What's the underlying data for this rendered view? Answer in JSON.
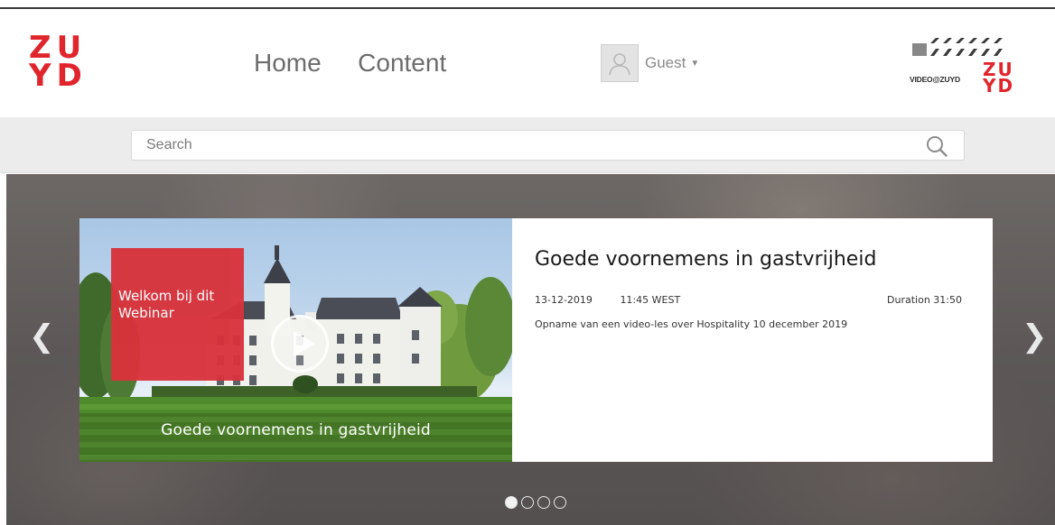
{
  "brand": {
    "logo_text": "ZUYD",
    "video_logo_text": "VIDEO@ZUYD",
    "brand_color": "#e0252c"
  },
  "nav": {
    "items": [
      {
        "label": "Home"
      },
      {
        "label": "Content"
      }
    ]
  },
  "user": {
    "name": "Guest",
    "avatar_icon": "user-silhouette-icon",
    "caret_icon": "caret-down-icon"
  },
  "search": {
    "placeholder": "Search",
    "value": "",
    "icon": "search-icon"
  },
  "carousel": {
    "prev_icon": "chevron-left-icon",
    "next_icon": "chevron-right-icon",
    "slide_count": 4,
    "active_index": 0,
    "slide": {
      "overlay_text": "Welkom bij dit Webinar",
      "thumbnail_caption": "Goede voornemens in gastvrijheid",
      "title": "Goede voornemens in gastvrijheid",
      "date": "13-12-2019",
      "time": "11:45 WEST",
      "duration": "Duration 31:50",
      "description": "Opname van een video-les over Hospitality 10 december 2019"
    }
  }
}
